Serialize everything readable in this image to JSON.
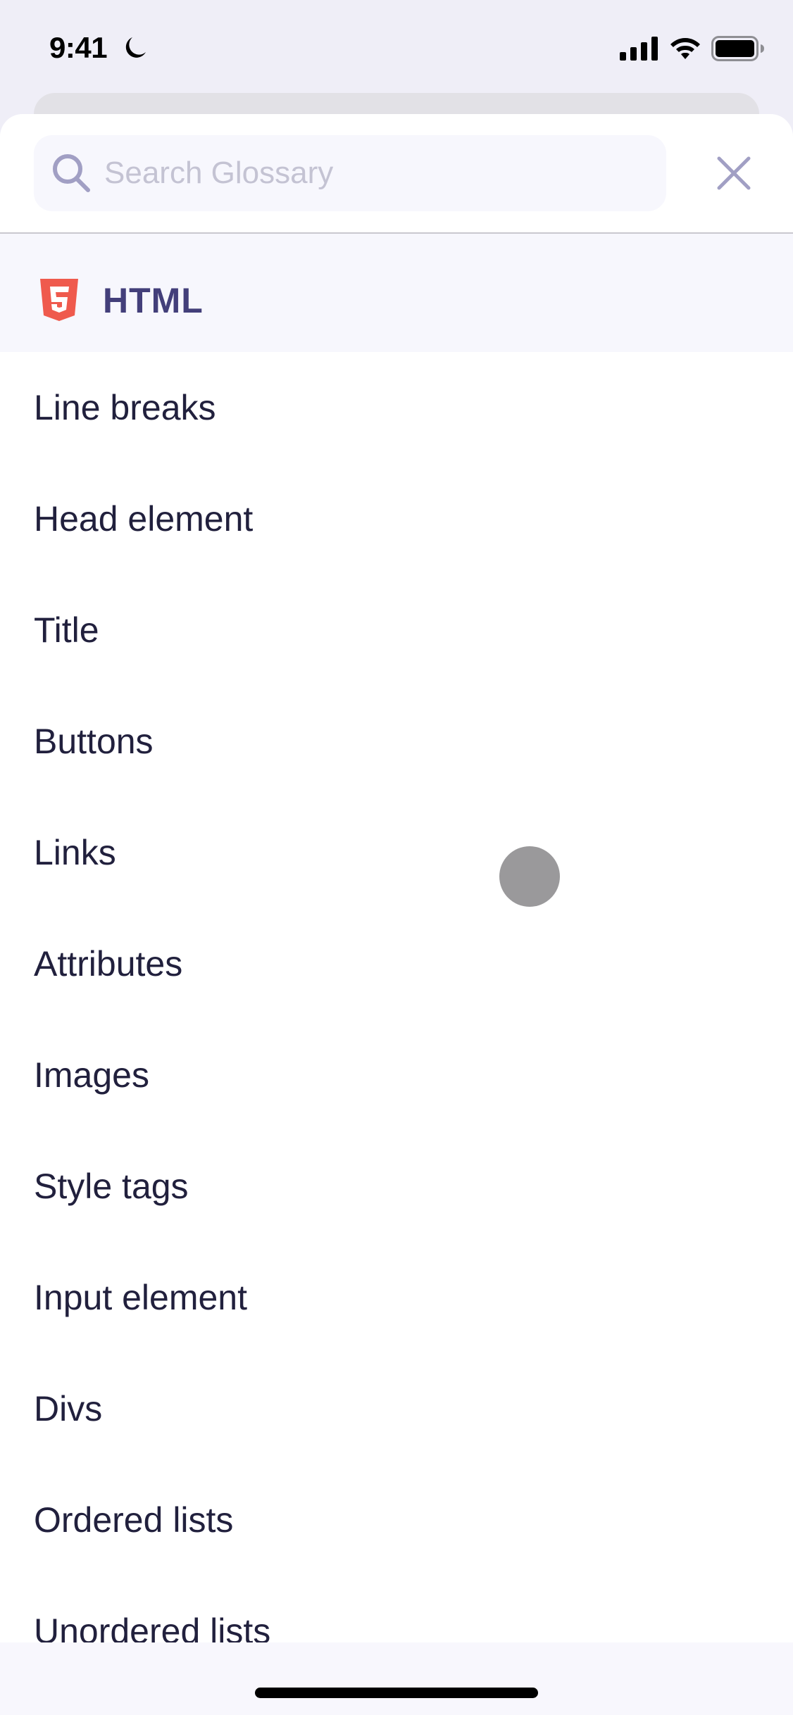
{
  "status_bar": {
    "time": "9:41",
    "focus_icon": "moon-icon",
    "icons": [
      "cellular-signal-icon",
      "wifi-icon",
      "battery-icon"
    ]
  },
  "search": {
    "placeholder": "Search Glossary",
    "value": "",
    "icon": "search-icon",
    "close_icon": "close-icon"
  },
  "section": {
    "icon": "html5-icon",
    "title": "HTML",
    "accent_color": "#ef5a4d",
    "title_color": "#433f7a"
  },
  "items": [
    {
      "label": "Line breaks"
    },
    {
      "label": "Head element"
    },
    {
      "label": "Title"
    },
    {
      "label": "Buttons"
    },
    {
      "label": "Links"
    },
    {
      "label": "Attributes"
    },
    {
      "label": "Images"
    },
    {
      "label": "Style tags"
    },
    {
      "label": "Input element"
    },
    {
      "label": "Divs"
    },
    {
      "label": "Ordered lists"
    },
    {
      "label": "Unordered lists"
    }
  ],
  "colors": {
    "background": "#efeef7",
    "sheet": "#ffffff",
    "search_field": "#f7f7fd",
    "icon_tint": "#a19fc4",
    "text": "#21203d"
  }
}
